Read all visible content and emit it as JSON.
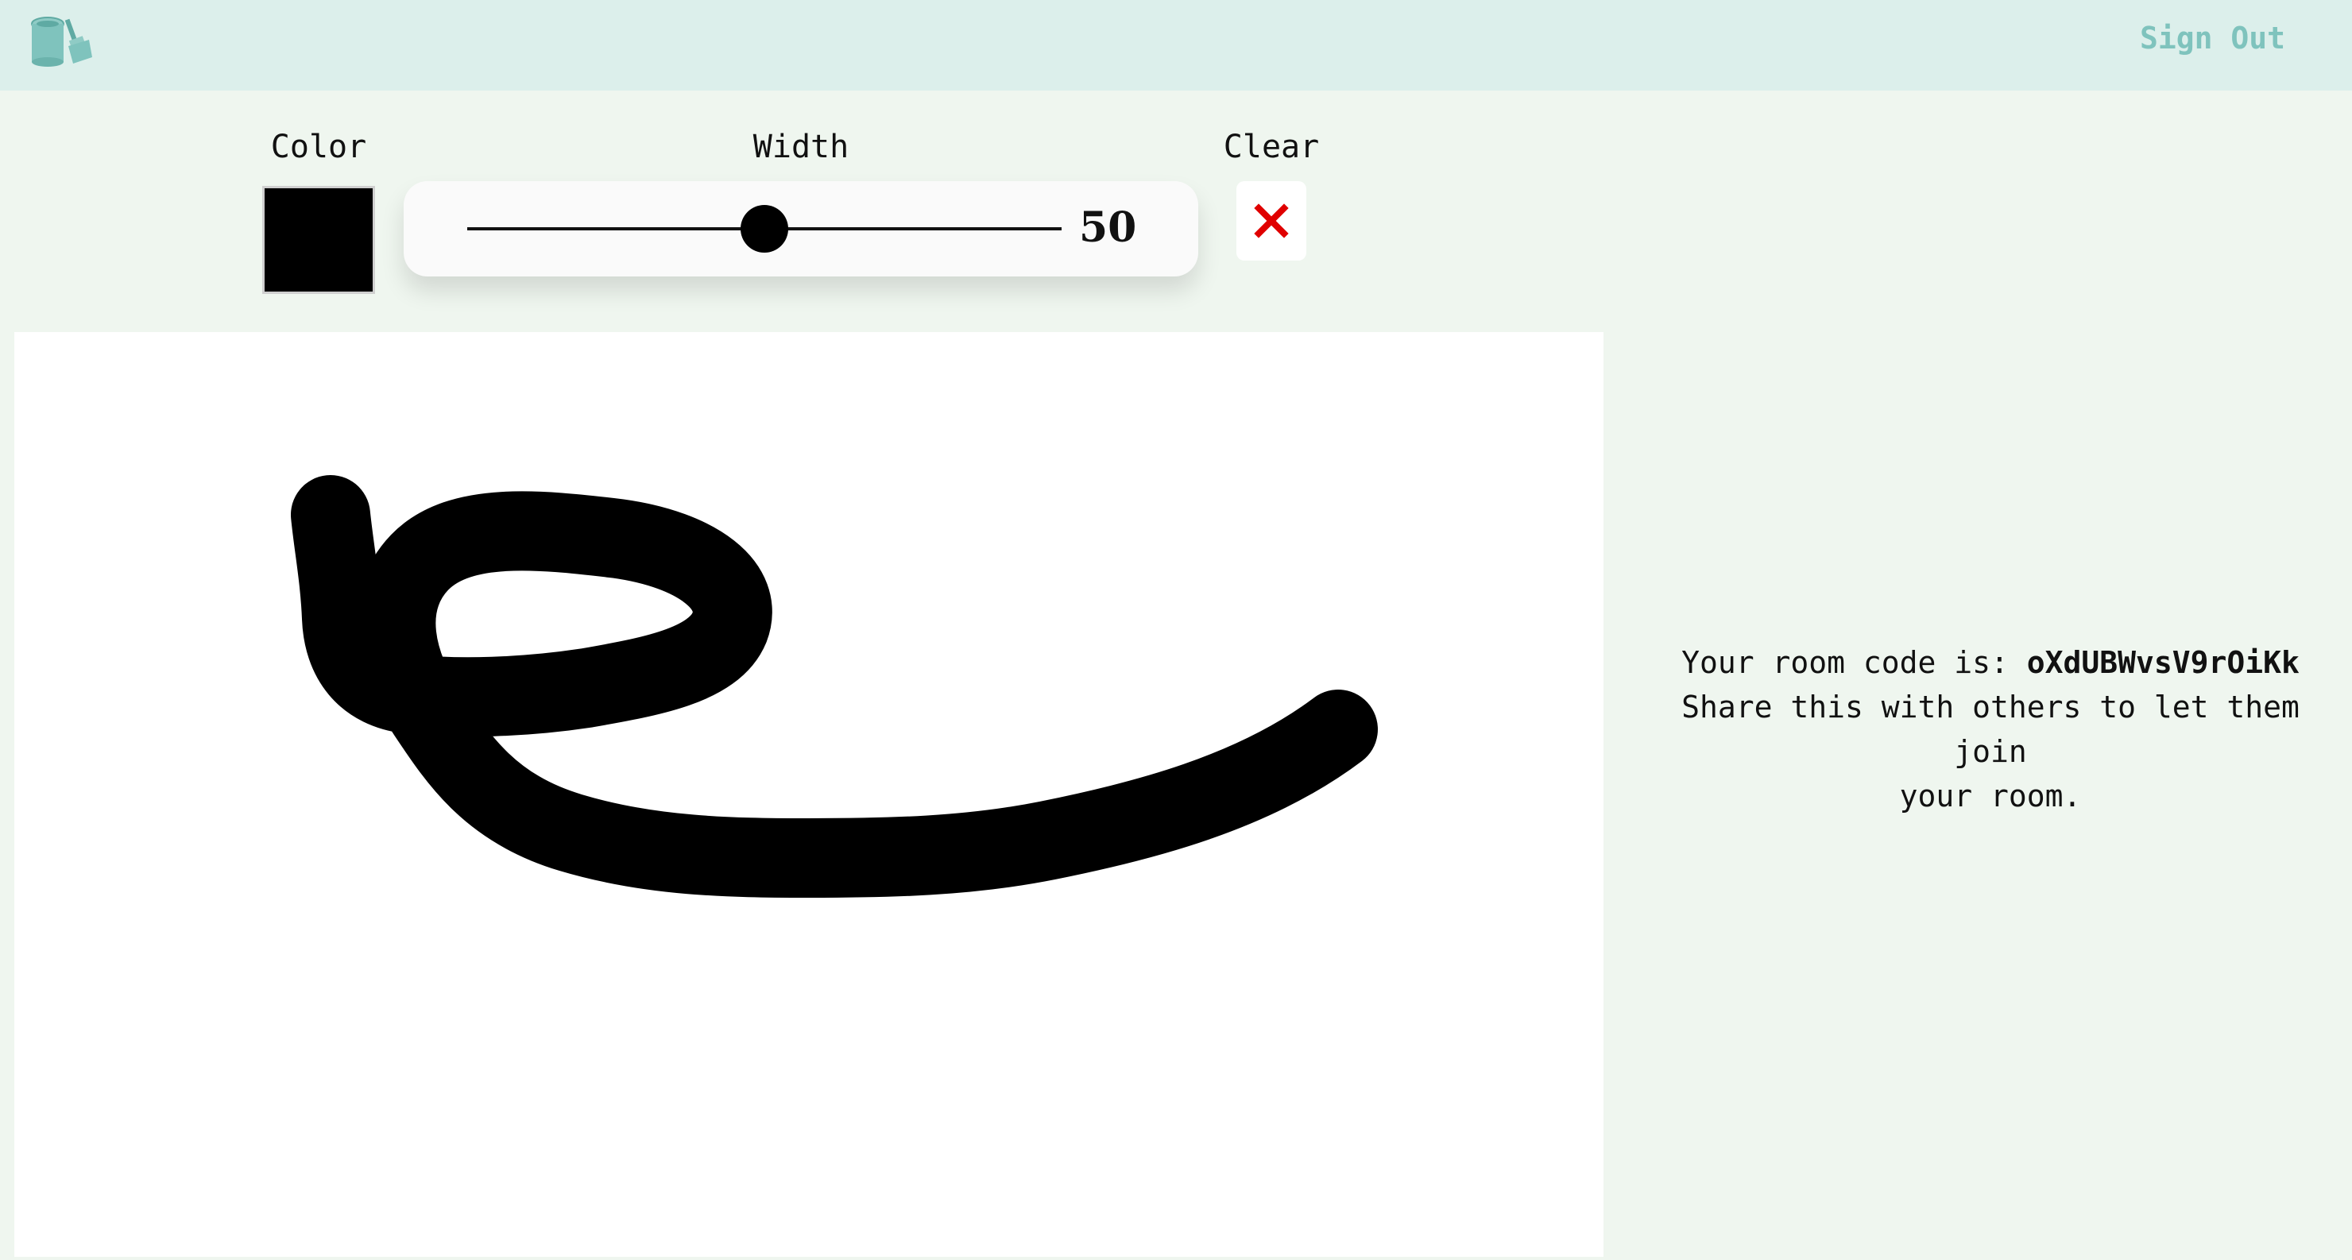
{
  "header": {
    "logo_icon": "paint-bucket-brush-icon",
    "sign_out_label": "Sign Out",
    "background_color": "#dcefeb",
    "accent_color": "#7fc3bd"
  },
  "toolbar": {
    "color_label": "Color",
    "width_label": "Width",
    "clear_label": "Clear",
    "selected_color": "#000000",
    "width_value": "50",
    "width_slider_fraction": 0.5,
    "clear_icon": "close-icon",
    "clear_icon_color": "#e00000"
  },
  "canvas": {
    "background": "#ffffff",
    "stroke_color": "#000000"
  },
  "room": {
    "code_prefix": "Your room code is:",
    "code": "oXdUBWvsV9rOiKk",
    "share_line1": "Share this with others to let them join",
    "share_line2": "your room."
  }
}
